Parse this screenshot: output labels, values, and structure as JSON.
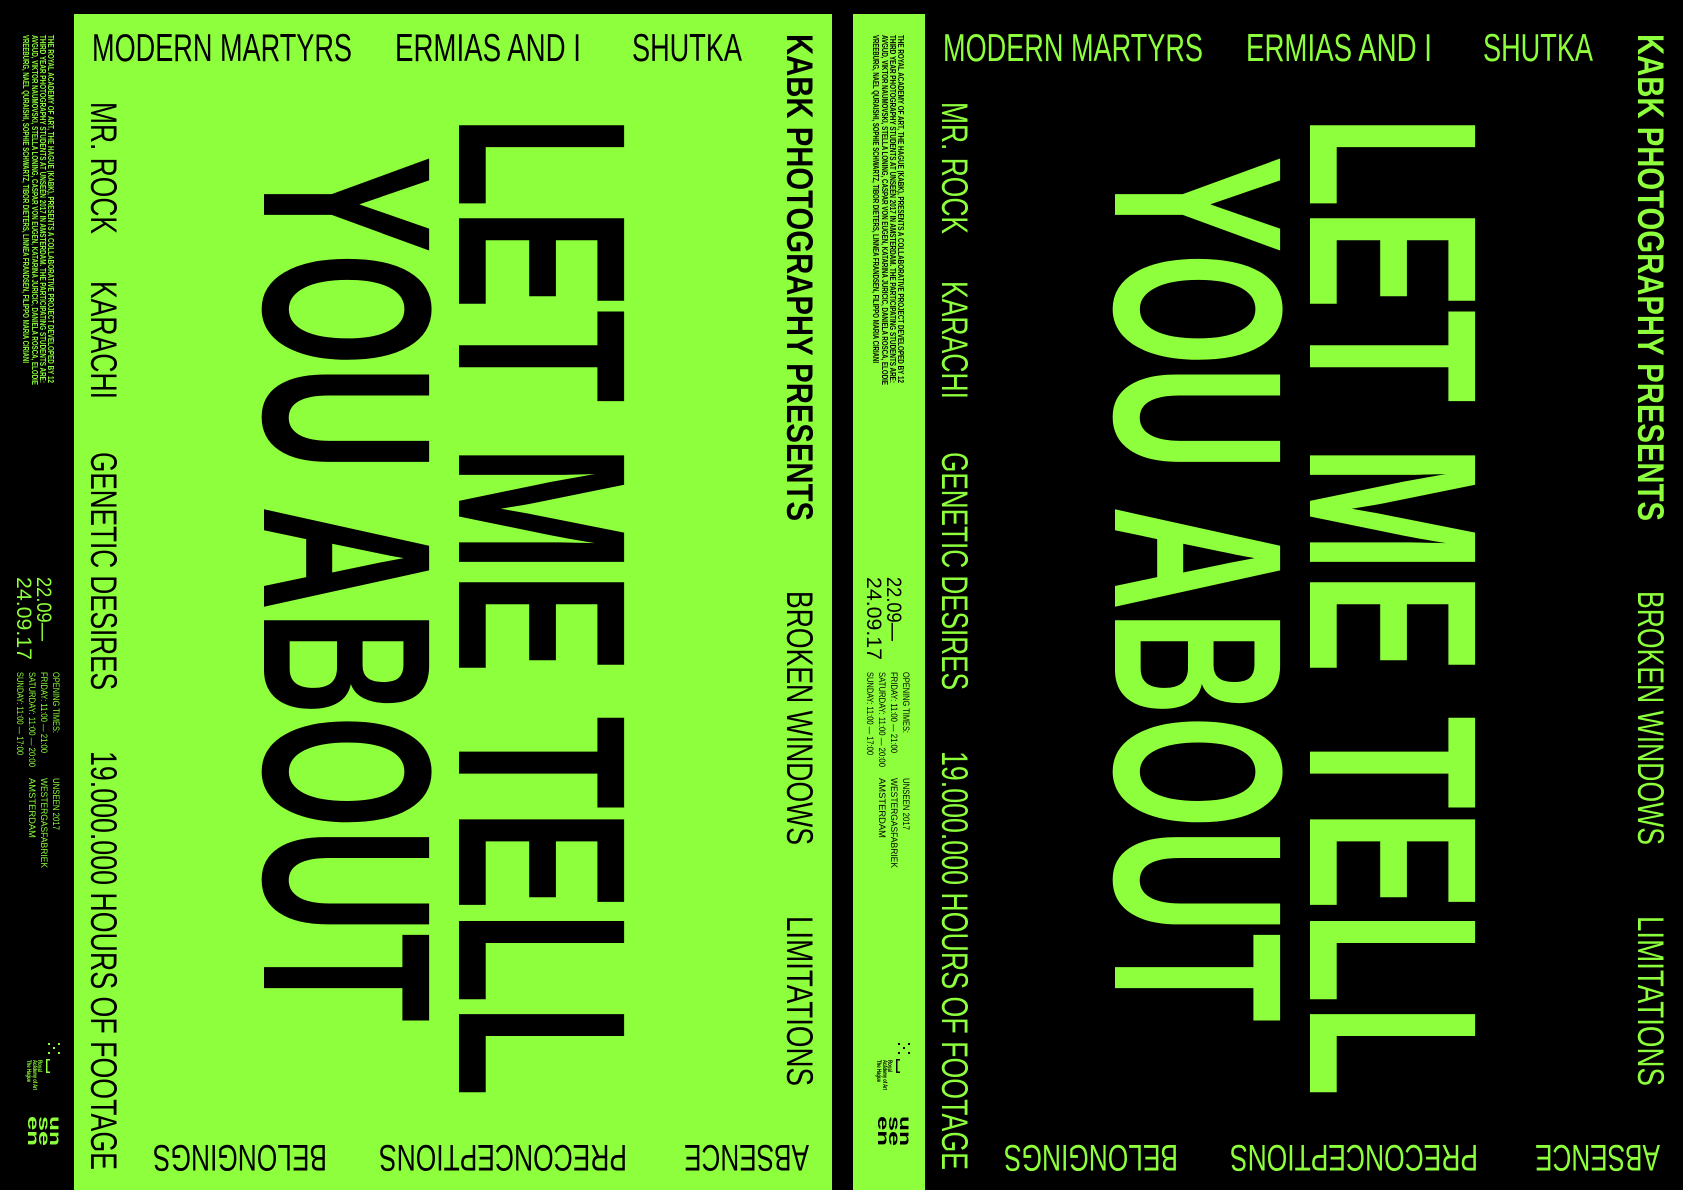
{
  "colors": {
    "green": "#8dff3c",
    "black": "#000000"
  },
  "poster": {
    "top_row": [
      "MODERN MARTYRS",
      "ERMIAS AND I",
      "SHUTKA"
    ],
    "left_column": [
      "MR. ROCK",
      "KARACHI",
      "GENETIC DESIRES",
      "19.000.000 HOURS OF FOOTAGE"
    ],
    "presenter": "KABK PHOTOGRAPHY PRESENTS",
    "right_column": [
      "BROKEN WINDOWS",
      "LIMITATIONS"
    ],
    "bottom_row": [
      "ABSENCE",
      "PRECONCEPTIONS",
      "BELONGINGS"
    ],
    "title_lines": [
      "LET ME TELL",
      "YOU ABOUT"
    ]
  },
  "strip": {
    "description_lines": [
      "THE ROYAL ACADEMY OF ART, THE HAGUE (KABK), PRESENTS A COLLABORATIVE PROJECT DEVELOPED BY 12",
      "THIRD YEAR PHOTOGRAPHY STUDENTS AT UNSEEN 2017 IN AMSTERDAM. THE PARTICIPATING STUDENTS ARE:",
      "AVGUD, VIKTOR NAUMOVSKI, STELLA LONING, CASPAR VON EUGEN, KATARINA JURICIC, DANIELA ROSCA, ELODIE",
      "VREEBURG, NAEL QURAISHI, SOPHIE SCHWARTZ, TIBOR DIETERS, LINNEA FRANDSEN, FILIPPO MARIA CIRIANI"
    ],
    "dates": [
      "22.09—",
      "24.09.17"
    ],
    "opening_times": [
      "OPENING TIMES:",
      "FRIDAY: 11:00 — 21:00",
      "SATURDAY: 11:00 — 20:00",
      "SUNDAY: 11:00 — 17:00"
    ],
    "venue": [
      "UNSEEN 2017",
      "WESTERGASFABRIEK",
      "AMSTERDAM"
    ],
    "logo": {
      "kabk": [
        "Royal",
        "Academy of Art",
        "The Hague"
      ],
      "unseen": [
        "un",
        "se",
        "en"
      ]
    }
  }
}
